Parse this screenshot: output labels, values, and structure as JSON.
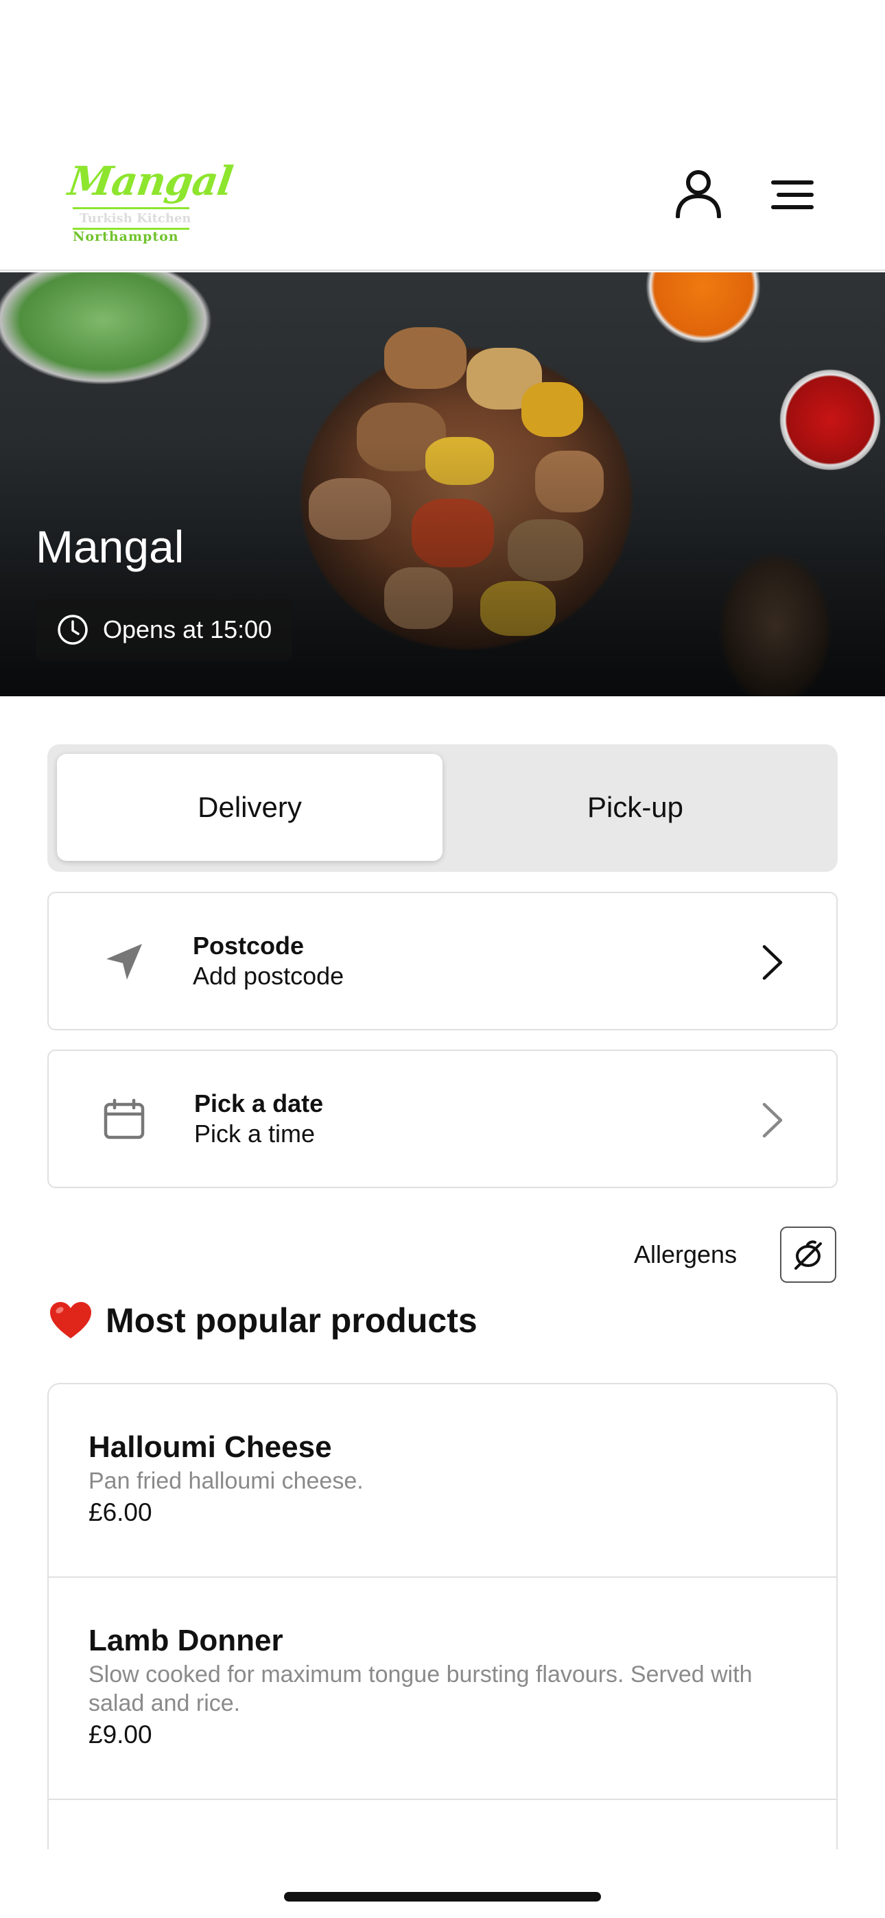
{
  "brand": {
    "logo_script": "Mangal",
    "logo_subtitle": "Turkish Kitchen",
    "logo_city": "Northampton",
    "accent_color": "#8ee52e"
  },
  "header": {
    "account_icon": "person-icon",
    "menu_icon": "hamburger-menu-icon"
  },
  "hero": {
    "title": "Mangal",
    "opening_status": "Opens at 15:00",
    "status_icon": "clock-icon"
  },
  "order_mode": {
    "options": [
      "Delivery",
      "Pick-up"
    ],
    "selected": "Delivery"
  },
  "postcode_card": {
    "icon": "location-arrow-icon",
    "title": "Postcode",
    "subtitle": "Add postcode"
  },
  "schedule_card": {
    "icon": "calendar-icon",
    "title": "Pick a date",
    "subtitle": "Pick a time"
  },
  "allergens": {
    "label": "Allergens",
    "icon": "allergen-icon"
  },
  "popular": {
    "emoji": "❤️",
    "title": "Most popular products",
    "items": [
      {
        "name": "Halloumi Cheese",
        "description": "Pan fried halloumi cheese.",
        "price": "£6.00"
      },
      {
        "name": "Lamb Donner",
        "description": "Slow cooked for maximum tongue bursting flavours. Served with salad and rice.",
        "price": "£9.00"
      }
    ]
  }
}
